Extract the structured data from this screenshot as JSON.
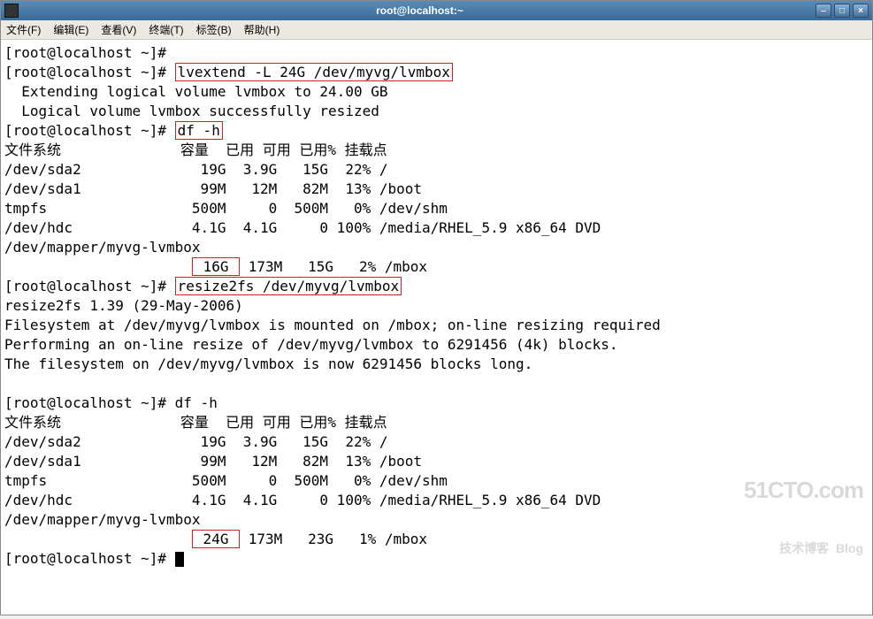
{
  "window": {
    "title": "root@localhost:~"
  },
  "menu": {
    "file": "文件(F)",
    "edit": "编辑(E)",
    "view": "查看(V)",
    "terminal": "终端(T)",
    "tab": "标签(B)",
    "help": "帮助(H)"
  },
  "prompt": "[root@localhost ~]# ",
  "cmd": {
    "empty": "",
    "lvextend": "lvextend -L 24G /dev/myvg/lvmbox",
    "dfh1": "df -h",
    "resize2fs": "resize2fs /dev/myvg/lvmbox",
    "dfh2": "df -h"
  },
  "output": {
    "ext1": "  Extending logical volume lvmbox to 24.00 GB",
    "ext2": "  Logical volume lvmbox successfully resized",
    "df_header_fs": "文件系统",
    "df_header_rest": "              容量  已用 可用 已用% 挂载点",
    "df1_rows": {
      "r1": "/dev/sda2              19G  3.9G   15G  22% /",
      "r2": "/dev/sda1              99M   12M   82M  13% /boot",
      "r3": "tmpfs                 500M     0  500M   0% /dev/shm",
      "r4": "/dev/hdc              4.1G  4.1G     0 100% /media/RHEL_5.9 x86_64 DVD",
      "r5": "/dev/mapper/myvg-lvmbox"
    },
    "df1_mbox_pre": "                      ",
    "df1_mbox_size": " 16G ",
    "df1_mbox_rest": " 173M   15G   2% /mbox",
    "resize_v": "resize2fs 1.39 (29-May-2006)",
    "resize_l1": "Filesystem at /dev/myvg/lvmbox is mounted on /mbox; on-line resizing required",
    "resize_l2": "Performing an on-line resize of /dev/myvg/lvmbox to 6291456 (4k) blocks.",
    "resize_l3": "The filesystem on /dev/myvg/lvmbox is now 6291456 blocks long.",
    "df2_rows": {
      "r1": "/dev/sda2              19G  3.9G   15G  22% /",
      "r2": "/dev/sda1              99M   12M   82M  13% /boot",
      "r3": "tmpfs                 500M     0  500M   0% /dev/shm",
      "r4": "/dev/hdc              4.1G  4.1G     0 100% /media/RHEL_5.9 x86_64 DVD",
      "r5": "/dev/mapper/myvg-lvmbox"
    },
    "df2_mbox_pre": "                      ",
    "df2_mbox_size": " 24G ",
    "df2_mbox_rest": " 173M   23G   1% /mbox"
  },
  "watermark": {
    "line1": "51CTO.com",
    "line2": "技术博客  Blog"
  }
}
